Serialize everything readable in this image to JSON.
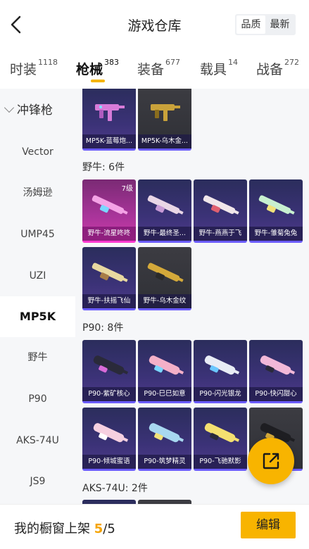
{
  "header": {
    "title": "游戏仓库",
    "sort_options": [
      "品质",
      "最新"
    ],
    "sort_selected": "品质"
  },
  "tabs": [
    {
      "label": "时装",
      "count": "1118"
    },
    {
      "label": "枪械",
      "count": "383"
    },
    {
      "label": "装备",
      "count": "677"
    },
    {
      "label": "载具",
      "count": "14"
    },
    {
      "label": "战备",
      "count": "272"
    }
  ],
  "sidebar": {
    "group": "冲锋枪",
    "items": [
      "Vector",
      "汤姆逊",
      "UMP45",
      "UZI",
      "MP5K",
      "野牛",
      "P90",
      "AKS-74U",
      "JS9"
    ],
    "active": "MP5K"
  },
  "sections": {
    "mp5k": {
      "items": [
        "MP5K-蓝莓炮...",
        "MP5K-乌木金..."
      ]
    },
    "bizon": {
      "label": "野牛: 6件",
      "items": [
        "野牛-流星咚咚",
        "野牛-最终圣...",
        "野牛-燕燕于飞",
        "野牛-雏菊兔兔",
        "野牛-扶摇飞仙",
        "野牛-乌木金纹"
      ],
      "first_level": "7级"
    },
    "p90": {
      "label": "P90: 8件",
      "items": [
        "P90-紫矿核心",
        "P90-巳巳如意",
        "P90-闪光银龙",
        "P90-快闪甜心",
        "P90-倾城蜜语",
        "P90-筑梦精灵",
        "P90-飞驰默影"
      ]
    },
    "aks": {
      "label": "AKS-74U: 2件"
    }
  },
  "bottom": {
    "label": "我的橱窗上架",
    "current": "5",
    "separator": "/",
    "total": "5",
    "edit_label": "编辑"
  },
  "colors": {
    "accent": "#f8b400",
    "rare_purple": "#6b5cff",
    "legendary_pink": "#ff3bd0"
  }
}
